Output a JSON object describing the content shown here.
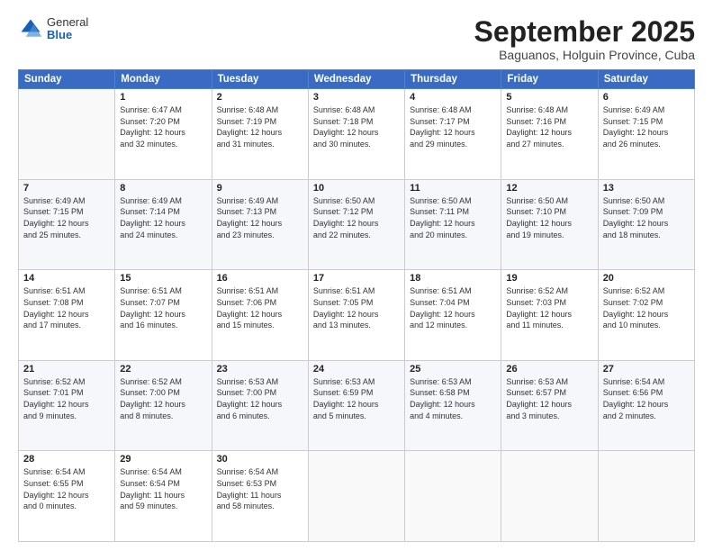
{
  "logo": {
    "general": "General",
    "blue": "Blue"
  },
  "header": {
    "title": "September 2025",
    "subtitle": "Baguanos, Holguin Province, Cuba"
  },
  "weekdays": [
    "Sunday",
    "Monday",
    "Tuesday",
    "Wednesday",
    "Thursday",
    "Friday",
    "Saturday"
  ],
  "weeks": [
    [
      {
        "day": "",
        "info": ""
      },
      {
        "day": "1",
        "info": "Sunrise: 6:47 AM\nSunset: 7:20 PM\nDaylight: 12 hours\nand 32 minutes."
      },
      {
        "day": "2",
        "info": "Sunrise: 6:48 AM\nSunset: 7:19 PM\nDaylight: 12 hours\nand 31 minutes."
      },
      {
        "day": "3",
        "info": "Sunrise: 6:48 AM\nSunset: 7:18 PM\nDaylight: 12 hours\nand 30 minutes."
      },
      {
        "day": "4",
        "info": "Sunrise: 6:48 AM\nSunset: 7:17 PM\nDaylight: 12 hours\nand 29 minutes."
      },
      {
        "day": "5",
        "info": "Sunrise: 6:48 AM\nSunset: 7:16 PM\nDaylight: 12 hours\nand 27 minutes."
      },
      {
        "day": "6",
        "info": "Sunrise: 6:49 AM\nSunset: 7:15 PM\nDaylight: 12 hours\nand 26 minutes."
      }
    ],
    [
      {
        "day": "7",
        "info": "Sunrise: 6:49 AM\nSunset: 7:15 PM\nDaylight: 12 hours\nand 25 minutes."
      },
      {
        "day": "8",
        "info": "Sunrise: 6:49 AM\nSunset: 7:14 PM\nDaylight: 12 hours\nand 24 minutes."
      },
      {
        "day": "9",
        "info": "Sunrise: 6:49 AM\nSunset: 7:13 PM\nDaylight: 12 hours\nand 23 minutes."
      },
      {
        "day": "10",
        "info": "Sunrise: 6:50 AM\nSunset: 7:12 PM\nDaylight: 12 hours\nand 22 minutes."
      },
      {
        "day": "11",
        "info": "Sunrise: 6:50 AM\nSunset: 7:11 PM\nDaylight: 12 hours\nand 20 minutes."
      },
      {
        "day": "12",
        "info": "Sunrise: 6:50 AM\nSunset: 7:10 PM\nDaylight: 12 hours\nand 19 minutes."
      },
      {
        "day": "13",
        "info": "Sunrise: 6:50 AM\nSunset: 7:09 PM\nDaylight: 12 hours\nand 18 minutes."
      }
    ],
    [
      {
        "day": "14",
        "info": "Sunrise: 6:51 AM\nSunset: 7:08 PM\nDaylight: 12 hours\nand 17 minutes."
      },
      {
        "day": "15",
        "info": "Sunrise: 6:51 AM\nSunset: 7:07 PM\nDaylight: 12 hours\nand 16 minutes."
      },
      {
        "day": "16",
        "info": "Sunrise: 6:51 AM\nSunset: 7:06 PM\nDaylight: 12 hours\nand 15 minutes."
      },
      {
        "day": "17",
        "info": "Sunrise: 6:51 AM\nSunset: 7:05 PM\nDaylight: 12 hours\nand 13 minutes."
      },
      {
        "day": "18",
        "info": "Sunrise: 6:51 AM\nSunset: 7:04 PM\nDaylight: 12 hours\nand 12 minutes."
      },
      {
        "day": "19",
        "info": "Sunrise: 6:52 AM\nSunset: 7:03 PM\nDaylight: 12 hours\nand 11 minutes."
      },
      {
        "day": "20",
        "info": "Sunrise: 6:52 AM\nSunset: 7:02 PM\nDaylight: 12 hours\nand 10 minutes."
      }
    ],
    [
      {
        "day": "21",
        "info": "Sunrise: 6:52 AM\nSunset: 7:01 PM\nDaylight: 12 hours\nand 9 minutes."
      },
      {
        "day": "22",
        "info": "Sunrise: 6:52 AM\nSunset: 7:00 PM\nDaylight: 12 hours\nand 8 minutes."
      },
      {
        "day": "23",
        "info": "Sunrise: 6:53 AM\nSunset: 7:00 PM\nDaylight: 12 hours\nand 6 minutes."
      },
      {
        "day": "24",
        "info": "Sunrise: 6:53 AM\nSunset: 6:59 PM\nDaylight: 12 hours\nand 5 minutes."
      },
      {
        "day": "25",
        "info": "Sunrise: 6:53 AM\nSunset: 6:58 PM\nDaylight: 12 hours\nand 4 minutes."
      },
      {
        "day": "26",
        "info": "Sunrise: 6:53 AM\nSunset: 6:57 PM\nDaylight: 12 hours\nand 3 minutes."
      },
      {
        "day": "27",
        "info": "Sunrise: 6:54 AM\nSunset: 6:56 PM\nDaylight: 12 hours\nand 2 minutes."
      }
    ],
    [
      {
        "day": "28",
        "info": "Sunrise: 6:54 AM\nSunset: 6:55 PM\nDaylight: 12 hours\nand 0 minutes."
      },
      {
        "day": "29",
        "info": "Sunrise: 6:54 AM\nSunset: 6:54 PM\nDaylight: 11 hours\nand 59 minutes."
      },
      {
        "day": "30",
        "info": "Sunrise: 6:54 AM\nSunset: 6:53 PM\nDaylight: 11 hours\nand 58 minutes."
      },
      {
        "day": "",
        "info": ""
      },
      {
        "day": "",
        "info": ""
      },
      {
        "day": "",
        "info": ""
      },
      {
        "day": "",
        "info": ""
      }
    ]
  ]
}
